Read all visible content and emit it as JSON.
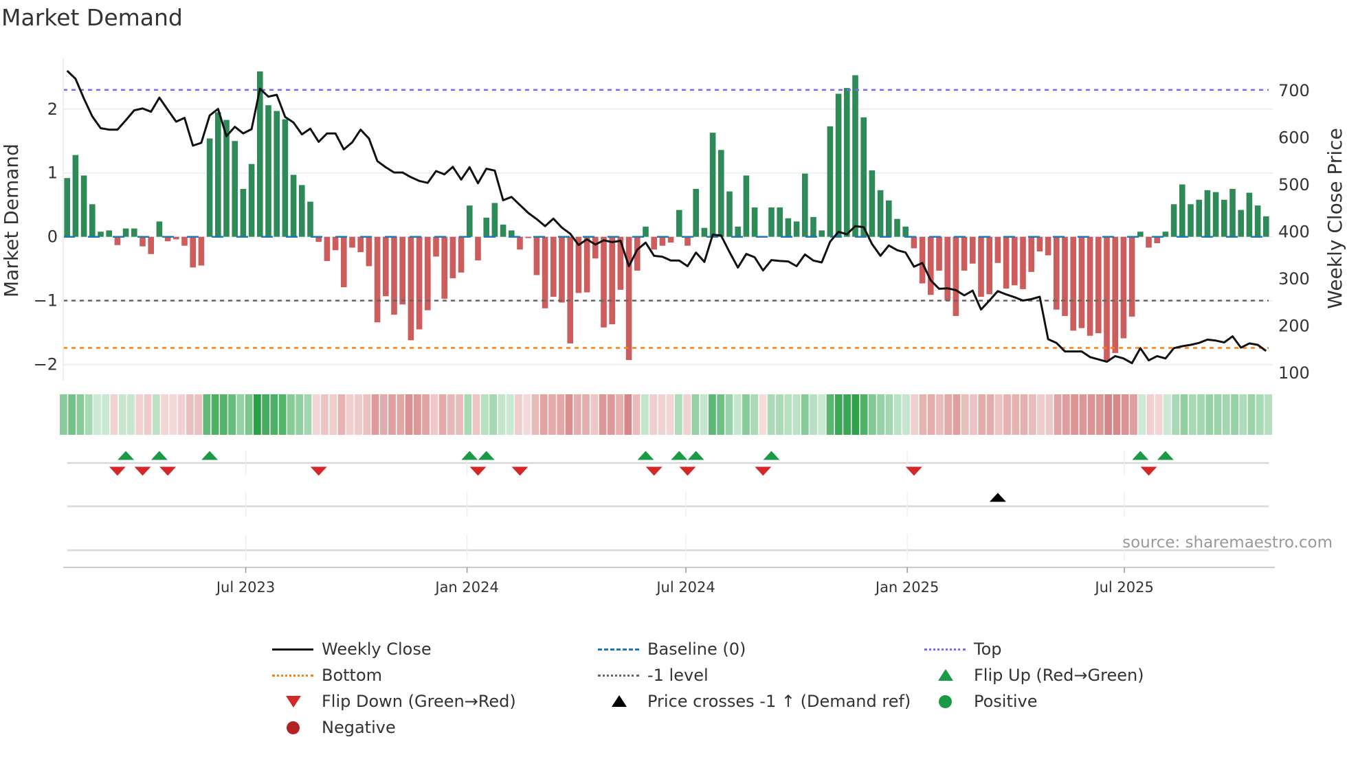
{
  "chart_data": {
    "type": "bar",
    "title": "Market Demand",
    "ylabel": "Market Demand",
    "ylabel_right": "Weekly Close Price",
    "ylim": [
      -2.23,
      2.74
    ],
    "ylim_right": [
      87,
      761
    ],
    "left_ticks": [
      {
        "v": 2,
        "label": "2"
      },
      {
        "v": 1,
        "label": "1"
      },
      {
        "v": 0,
        "label": "0"
      },
      {
        "v": -1,
        "label": "−1"
      },
      {
        "v": -2,
        "label": "−2"
      }
    ],
    "right_ticks": [
      {
        "v": 700,
        "label": "700"
      },
      {
        "v": 600,
        "label": "600"
      },
      {
        "v": 500,
        "label": "500"
      },
      {
        "v": 400,
        "label": "400"
      },
      {
        "v": 300,
        "label": "300"
      },
      {
        "v": 200,
        "label": "200"
      },
      {
        "v": 100,
        "label": "100"
      }
    ],
    "x_unit": "week index",
    "x_ticks": [
      {
        "week": 22.3,
        "label": "Jul 2023"
      },
      {
        "week": 48.7,
        "label": "Jan 2024"
      },
      {
        "week": 74.8,
        "label": "Jul 2024"
      },
      {
        "week": 101.2,
        "label": "Jan 2025"
      },
      {
        "week": 127.1,
        "label": "Jul 2025"
      }
    ],
    "reference_lines": {
      "top": 2.3,
      "bottom": -1.74,
      "minus_one": -1,
      "baseline": 0
    },
    "demand": [
      0.92,
      1.28,
      0.96,
      0.51,
      0.08,
      0.1,
      -0.13,
      0.13,
      0.13,
      -0.15,
      -0.27,
      0.24,
      -0.07,
      -0.04,
      -0.14,
      -0.48,
      -0.45,
      1.54,
      1.95,
      1.83,
      1.5,
      0.75,
      1.14,
      2.59,
      2.06,
      1.97,
      1.84,
      0.97,
      0.81,
      0.55,
      -0.08,
      -0.38,
      -0.21,
      -0.79,
      -0.17,
      -0.24,
      -0.46,
      -1.34,
      -0.93,
      -1.22,
      -1.06,
      -1.62,
      -1.45,
      -1.15,
      -0.31,
      -0.97,
      -0.65,
      -0.56,
      0.49,
      -0.37,
      0.3,
      0.53,
      0.19,
      0.1,
      -0.2,
      -0.02,
      -0.6,
      -1.12,
      -0.94,
      -1.03,
      -1.67,
      -0.88,
      -0.87,
      -0.34,
      -1.42,
      -1.37,
      -0.83,
      -1.93,
      -0.53,
      0.16,
      -0.2,
      -0.14,
      -0.09,
      0.42,
      -0.14,
      0.75,
      0.14,
      1.63,
      1.36,
      0.71,
      0.16,
      0.96,
      0.46,
      -0.01,
      0.46,
      0.46,
      0.29,
      0.24,
      0.99,
      0.31,
      0.1,
      1.73,
      2.24,
      2.33,
      2.53,
      1.87,
      1.04,
      0.73,
      0.57,
      0.28,
      0.16,
      -0.18,
      -0.73,
      -0.91,
      -0.53,
      -1.0,
      -1.24,
      -0.53,
      -0.42,
      -0.94,
      -0.9,
      -0.41,
      -0.81,
      -0.76,
      -0.82,
      -0.55,
      -0.23,
      -0.29,
      -1.14,
      -1.24,
      -1.47,
      -1.43,
      -1.55,
      -1.51,
      -1.95,
      -1.82,
      -1.59,
      -1.25,
      0.08,
      -0.17,
      -0.1,
      0.08,
      0.51,
      0.82,
      0.51,
      0.58,
      0.73,
      0.7,
      0.58,
      0.75,
      0.42,
      0.69,
      0.49,
      0.32
    ],
    "close": [
      742,
      725,
      683,
      645,
      620,
      617,
      617,
      637,
      658,
      662,
      655,
      685,
      659,
      634,
      642,
      583,
      589,
      647,
      661,
      603,
      623,
      609,
      618,
      704,
      687,
      691,
      644,
      632,
      607,
      619,
      591,
      609,
      609,
      575,
      590,
      617,
      598,
      550,
      537,
      526,
      526,
      516,
      508,
      504,
      529,
      522,
      538,
      511,
      537,
      503,
      534,
      530,
      467,
      474,
      457,
      440,
      427,
      412,
      428,
      409,
      396,
      372,
      384,
      373,
      382,
      378,
      381,
      327,
      362,
      377,
      349,
      347,
      339,
      339,
      327,
      356,
      336,
      394,
      392,
      357,
      324,
      353,
      346,
      318,
      340,
      338,
      337,
      327,
      352,
      339,
      335,
      379,
      400,
      395,
      412,
      410,
      374,
      349,
      371,
      361,
      356,
      326,
      334,
      297,
      279,
      280,
      276,
      265,
      275,
      235,
      254,
      274,
      267,
      261,
      254,
      257,
      262,
      172,
      164,
      146,
      146,
      146,
      134,
      129,
      124,
      136,
      131,
      121,
      153,
      127,
      136,
      131,
      153,
      157,
      160,
      164,
      171,
      169,
      165,
      178,
      154,
      163,
      160,
      147
    ],
    "flip_up_weeks": [
      8,
      12,
      18,
      49,
      51,
      70,
      74,
      76,
      85,
      129,
      132
    ],
    "flip_down_weeks": [
      7,
      10,
      13,
      31,
      50,
      55,
      71,
      75,
      84,
      102,
      130
    ],
    "price_cross_weeks": [
      112
    ],
    "grid": true,
    "legend_position": "bottom"
  },
  "colors": {
    "positive_bar": "#2e8b57",
    "negative_bar": "#cd5c5c",
    "close_line": "#111111",
    "baseline": "#1f77b4",
    "top": "#7b68ee",
    "bottom": "#ff7f0e",
    "minus_one": "#666666",
    "flip_up": "#1a9a45",
    "flip_down": "#d62728",
    "positive_dot": "#1a9a45",
    "negative_dot": "#b22222"
  },
  "source": "source: sharemaestro.com",
  "legend": {
    "weekly_close": "Weekly Close",
    "baseline": "Baseline (0)",
    "top": "Top",
    "bottom": "Bottom",
    "minus_one": "-1 level",
    "flip_up": "Flip Up (Red→Green)",
    "flip_down": "Flip Down (Green→Red)",
    "price_cross": "Price crosses -1 ↑ (Demand ref)",
    "positive": "Positive",
    "negative": "Negative"
  }
}
